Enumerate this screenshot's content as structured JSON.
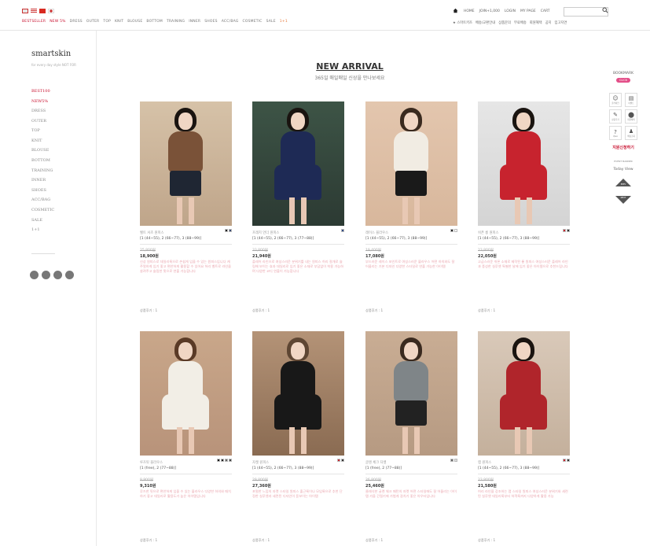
{
  "top": {
    "categories": [
      "BESTSELLER",
      "NEW 5%",
      "DRESS",
      "OUTER",
      "TOP",
      "KNIT",
      "BLOUSE",
      "BOTTOM",
      "TRAINING",
      "INNER",
      "SHOES",
      "ACC/BAG",
      "COSMETIC",
      "SALE",
      "1+1"
    ],
    "links": [
      "HOME",
      "JOIN+1,000",
      "LOGIN",
      "MY PAGE",
      "CART"
    ],
    "sublinks": [
      "★ 스마트키즈",
      "배송/교환안내",
      "상품문의",
      "무료배송",
      "회원혜택",
      "공지",
      "입고지연"
    ]
  },
  "sidebar": {
    "logo": "smartskin",
    "tagline": "for every day style NOT FOR",
    "items": [
      "BEST100",
      "NEW5%",
      "DRESS",
      "OUTER",
      "TOP",
      "KNIT",
      "BLOUSE",
      "BOTTOM",
      "TRAINING",
      "INNER",
      "SHOES",
      "ACC/BAG",
      "COSMETIC",
      "SALE",
      "1+1"
    ]
  },
  "main": {
    "title": "NEW ARRIVAL",
    "subtitle": "365일 매일매일 신상을 만나보세요"
  },
  "products": [
    {
      "name": "벨트 셔츠 원피스",
      "size": "[1 (44~55), 2 (66~77), 3 (88~99)]",
      "old": "25,800원",
      "price": "18,900원",
      "desc": "신상 원피스로 데일리룩으로 손쉽게 입을 수 있는 원피스입니다 캐주얼하게 입기 좋고 편안하게 활용할 수 있어요 허리 벨트로 라인을 살려주고 슬림한 핏으로 연출 가능합니다",
      "reviews": "상품후기 : 1",
      "swatches": [
        "#222",
        "#3a4a70"
      ]
    },
    {
      "name": "프레치 언더 원피스",
      "size": "[1 (44~55), 2 (66~77), 3 (77~88)]",
      "old": "33,800원",
      "price": "21,940원",
      "desc": "플레어 라인으로 여성스러운 분위기를 내는 원피스 허리 절개로 슬림해 보이는 효과 데일리로 입기 좋은 소재로 부담없이 착용 가능하며 다양한 코디 연출이 가능합니다",
      "reviews": "상품후기 : 1",
      "swatches": [
        "#2e4a85"
      ]
    },
    {
      "name": "레이스 블라우스",
      "size": "[1 (44~55), 2 (66~77), 3 (88~99)]",
      "old": "19,400원",
      "price": "17,080원",
      "desc": "부드러운 레이스 포인트로 여성스러운 블라우스 어떤 하의와도 잘 어울리는 기본 디자인 다양한 스타일로 연출 가능한 아이템",
      "reviews": "상품후기 : 1",
      "swatches": [
        "#222",
        "#fff"
      ]
    },
    {
      "name": "쉬폰 롱 원피스",
      "size": "[1 (44~55), 2 (66~77), 3 (88~99)]",
      "old": "23,800원",
      "price": "22,050원",
      "desc": "고급스러운 쉬폰 소재로 제작된 롱 원피스 여성스러운 플레어 라인과 풍성한 실루엣 특별한 날에 입기 좋은 아이템으로 추천드립니다",
      "reviews": "상품후기 : 1",
      "swatches": [
        "#c8232c",
        "#333"
      ]
    },
    {
      "name": "루즈핏 블라우스",
      "size": "[1 (free), 2 (77~88)]",
      "old": "9,800원",
      "price": "9,310원",
      "desc": "루즈한 핏으로 편안하게 입을 수 있는 블라우스 다양한 하의와 매치하기 좋고 데일리로 활용도가 높은 아이템입니다",
      "reviews": "상품후기 : 1",
      "swatches": [
        "#111",
        "#222",
        "#666",
        "#444"
      ]
    },
    {
      "name": "자켓 원피스",
      "size": "[1 (44~55), 2 (66~77), 3 (88~99)]",
      "old": "29,800원",
      "price": "27,360원",
      "desc": "포멀한 느낌의 자켓 스타일 원피스 출근룩이나 모임룩으로 추천 단정한 실루엣과 세련된 디자인이 돋보이는 아이템",
      "reviews": "상품후기 : 1",
      "swatches": [
        "#c8232c",
        "#333"
      ]
    },
    {
      "name": "글렌 체크 자켓",
      "size": "[1 (free), 2 (77~88)]",
      "old": "26,800원",
      "price": "25,460원",
      "desc": "클래식한 글렌 체크 패턴의 자켓 어떤 스타일에도 잘 어울리는 아이템 가을 간절기에 가볍게 걸치기 좋은 아우터입니다",
      "reviews": "상품후기 : 1",
      "swatches": [
        "#666",
        "#ddd"
      ]
    },
    {
      "name": "랩 원피스",
      "size": "[1 (44~55), 2 (66~77), 3 (88~99)]",
      "old": "23,800원",
      "price": "21,580원",
      "desc": "허리 라인을 강조하는 랩 스타일 원피스 여성스러운 분위기와 세련된 실루엣 데일리룩부터 하객룩까지 다양하게 활용 가능",
      "reviews": "상품후기 : 1",
      "swatches": [
        "#c8232c",
        "#333"
      ]
    }
  ],
  "quick": {
    "bookmark": "BOOKMARK",
    "badge": "CLICK",
    "buttons": [
      {
        "icon": "☺",
        "label": "출석체크"
      },
      {
        "icon": "▤",
        "label": "이벤트"
      },
      {
        "icon": "✎",
        "label": "상품후기"
      },
      {
        "icon": "⬤",
        "label": "회원혜택"
      },
      {
        "icon": "?",
        "label": "Q&A"
      },
      {
        "icon": "♟",
        "label": "배송조회"
      }
    ],
    "banner_title": "지원신청하기",
    "banner_sub": "EVENT BANNER",
    "today": "Today View",
    "prev": "PREV",
    "next": "NEXT"
  }
}
